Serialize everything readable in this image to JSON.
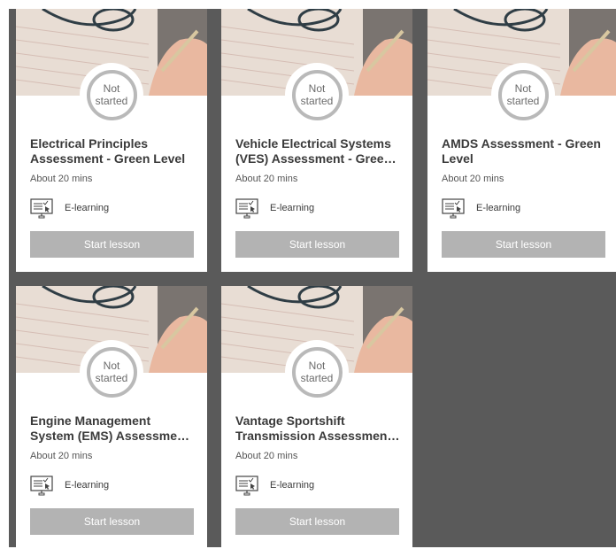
{
  "cards": [
    {
      "status_line1": "Not",
      "status_line2": "started",
      "title": "Electrical Principles Assessment - Green Level",
      "duration": "About 20 mins",
      "type_label": "E-learning",
      "button_label": "Start lesson"
    },
    {
      "status_line1": "Not",
      "status_line2": "started",
      "title": "Vehicle Electrical Systems (VES) Assessment - Green Level",
      "duration": "About 20 mins",
      "type_label": "E-learning",
      "button_label": "Start lesson"
    },
    {
      "status_line1": "Not",
      "status_line2": "started",
      "title": "AMDS Assessment - Green Level",
      "duration": "About 20 mins",
      "type_label": "E-learning",
      "button_label": "Start lesson"
    },
    {
      "status_line1": "Not",
      "status_line2": "started",
      "title": "Engine Management System (EMS) Assessment - Green Level",
      "duration": "About 20 mins",
      "type_label": "E-learning",
      "button_label": "Start lesson"
    },
    {
      "status_line1": "Not",
      "status_line2": "started",
      "title": "Vantage Sportshift Transmission Assessment - Green Level",
      "duration": "About 20 mins",
      "type_label": "E-learning",
      "button_label": "Start lesson"
    }
  ],
  "colors": {
    "background": "#5a5a5a",
    "card": "#ffffff",
    "button": "#b3b3b3",
    "status_ring": "#b9b9b9"
  },
  "icons": {
    "type_icon": "elearning-monitor-icon",
    "image": "assessment-paper-glasses-image"
  }
}
